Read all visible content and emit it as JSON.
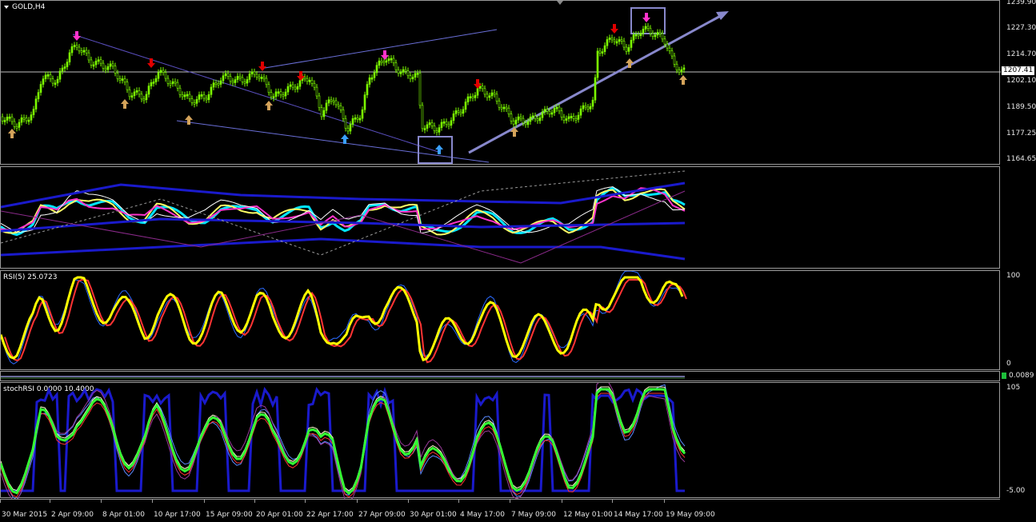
{
  "chart": {
    "symbol_label": "GOLD,H4",
    "current_price": "1207.41",
    "price_ticks": [
      "1239.90",
      "1227.30",
      "1214.70",
      "1202.10",
      "1189.50",
      "1177.25",
      "1164.65"
    ],
    "time_ticks": [
      "30 Mar 2015",
      "2 Apr 09:00",
      "8 Apr 01:00",
      "10 Apr 17:00",
      "15 Apr 09:00",
      "20 Apr 01:00",
      "22 Apr 17:00",
      "27 Apr 09:00",
      "30 Apr 01:00",
      "4 May 17:00",
      "7 May 09:00",
      "12 May 01:00",
      "14 May 17:00",
      "19 May 09:00"
    ]
  },
  "indicators": {
    "rsi_label": "RSI(5) 25.0723",
    "rsi_scale_top": "100",
    "rsi_scale_bottom": "0",
    "strip_value": "0.0089",
    "stoch_label": "stochRSI 0.0000 10.4000",
    "stoch_scale_top": "105",
    "stoch_scale_bottom": "-5.00"
  },
  "colors": {
    "candle": "#7cfc00",
    "arrow_up": "#d4a35a",
    "arrow_down": "#e00000",
    "arrow_blue": "#3aa0ff",
    "arrow_magenta": "#ff33cc",
    "trend": "#8888cc",
    "rsi_main": "#ffff00"
  }
}
